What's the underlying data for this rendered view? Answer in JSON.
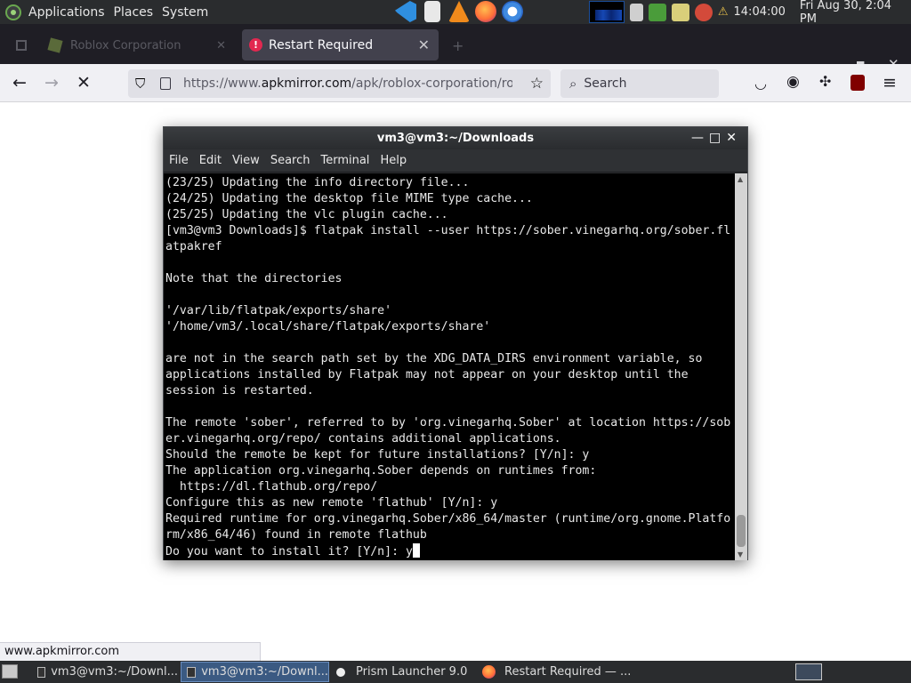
{
  "top_panel": {
    "menus": [
      "Applications",
      "Places",
      "System"
    ],
    "launchers": [
      {
        "icon": "vscode-icon",
        "color": "#2f8fe0"
      },
      {
        "icon": "text-editor-icon",
        "color": "#e8e8e8"
      },
      {
        "icon": "vlc-icon",
        "color": "#f08a1c"
      },
      {
        "icon": "firefox-icon",
        "color": "#ff7139"
      },
      {
        "icon": "chromium-icon",
        "color": "#3f8ae0"
      }
    ],
    "clock": "14:04:00",
    "date": "Fri Aug 30,  2:04 PM"
  },
  "browser": {
    "tabs": [
      {
        "label": "Roblox Corporation",
        "active": false
      },
      {
        "label": "Restart Required",
        "active": true
      }
    ],
    "url_prefix": "https://www.",
    "url_domain": "apkmirror.com",
    "url_rest": "/apk/roblox-corporation/roblox/",
    "search_placeholder": "Search",
    "status_url": "www.apkmirror.com"
  },
  "terminal": {
    "title": "vm3@vm3:~/Downloads",
    "menu": [
      "File",
      "Edit",
      "View",
      "Search",
      "Terminal",
      "Help"
    ],
    "lines": [
      "(23/25) Updating the info directory file...",
      "(24/25) Updating the desktop file MIME type cache...",
      "(25/25) Updating the vlc plugin cache...",
      "[vm3@vm3 Downloads]$ flatpak install --user https://sober.vinegarhq.org/sober.fl",
      "atpakref",
      "",
      "Note that the directories",
      "",
      "'/var/lib/flatpak/exports/share'",
      "'/home/vm3/.local/share/flatpak/exports/share'",
      "",
      "are not in the search path set by the XDG_DATA_DIRS environment variable, so",
      "applications installed by Flatpak may not appear on your desktop until the",
      "session is restarted.",
      "",
      "The remote 'sober', referred to by 'org.vinegarhq.Sober' at location https://sob",
      "er.vinegarhq.org/repo/ contains additional applications.",
      "Should the remote be kept for future installations? [Y/n]: y",
      "The application org.vinegarhq.Sober depends on runtimes from:",
      "  https://dl.flathub.org/repo/",
      "Configure this as new remote 'flathub' [Y/n]: y",
      "Required runtime for org.vinegarhq.Sober/x86_64/master (runtime/org.gnome.Platfo",
      "rm/x86_64/46) found in remote flathub"
    ],
    "prompt_line": "Do you want to install it? [Y/n]: y"
  },
  "taskbar": {
    "tasks": [
      {
        "label": "vm3@vm3:~/Downl...",
        "active": false
      },
      {
        "label": "vm3@vm3:~/Downl...",
        "active": true
      },
      {
        "label": "Prism Launcher 9.0",
        "active": false
      },
      {
        "label": "Restart Required — ...",
        "active": false
      }
    ]
  }
}
